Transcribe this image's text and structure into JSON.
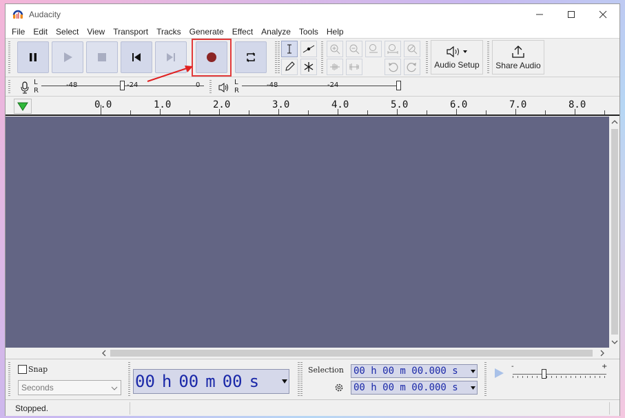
{
  "window": {
    "title": "Audacity",
    "minimize_icon": "minimize-icon",
    "maximize_icon": "maximize-icon",
    "close_icon": "close-icon"
  },
  "menu": [
    "File",
    "Edit",
    "Select",
    "View",
    "Transport",
    "Tracks",
    "Generate",
    "Effect",
    "Analyze",
    "Tools",
    "Help"
  ],
  "transport": {
    "buttons": [
      "pause",
      "play",
      "stop",
      "skip-to-start",
      "skip-to-end",
      "record",
      "loop"
    ],
    "record_color": "#8b2525",
    "highlight_color": "#e23a3a"
  },
  "audio_setup": {
    "label": "Audio Setup"
  },
  "share_audio": {
    "label": "Share Audio"
  },
  "record_meter": {
    "l": "L",
    "r": "R",
    "ticks": [
      "-48",
      "-24",
      "0"
    ]
  },
  "playback_meter": {
    "l": "L",
    "r": "R",
    "ticks": [
      "-48",
      "-24"
    ]
  },
  "ruler": {
    "labels": [
      "0.0",
      "1.0",
      "2.0",
      "3.0",
      "4.0",
      "5.0",
      "6.0",
      "7.0",
      "8.0"
    ]
  },
  "snap": {
    "label": "Snap",
    "checked": false
  },
  "seconds_select": {
    "value": "Seconds"
  },
  "time": {
    "h": "00",
    "h_unit": "h",
    "m": "00",
    "m_unit": "m",
    "s": "00",
    "s_unit": "s"
  },
  "selection": {
    "label": "Selection",
    "start": "00 h 00 m 00.000 s",
    "end": "00 h 00 m 00.000 s"
  },
  "play_speed": {
    "minus": "-",
    "plus": "+"
  },
  "status": {
    "text": "Stopped."
  }
}
